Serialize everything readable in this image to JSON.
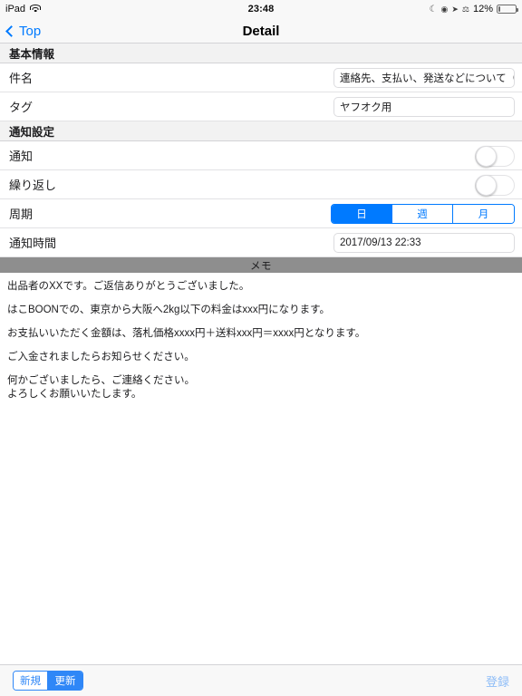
{
  "statusbar": {
    "device": "iPad",
    "wifi_icon": "wifi-icon",
    "time": "23:48",
    "moon_icon": "moon-icon",
    "alarm_icon": "alarm-clock-icon",
    "location_icon": "location-arrow-icon",
    "bluetooth_icon": "bluetooth-icon",
    "battery_percent": "12%",
    "battery_icon": "battery-icon"
  },
  "navbar": {
    "back_label": "Top",
    "back_icon": "chevron-left-icon",
    "title": "Detail"
  },
  "sections": [
    {
      "header": "基本情報",
      "rows": [
        {
          "label": "件名",
          "type": "textfield",
          "value": "連絡先、支払い、発送などについて（出…"
        },
        {
          "label": "タグ",
          "type": "textfield",
          "value": "ヤフオク用"
        }
      ]
    },
    {
      "header": "通知設定",
      "rows": [
        {
          "label": "通知",
          "type": "toggle",
          "value": "off"
        },
        {
          "label": "繰り返し",
          "type": "toggle",
          "value": "off"
        },
        {
          "label": "周期",
          "type": "segmented",
          "options": [
            "日",
            "週",
            "月"
          ],
          "selected": "日"
        },
        {
          "label": "通知時間",
          "type": "textfield",
          "value": "2017/09/13 22:33"
        }
      ]
    }
  ],
  "memo": {
    "header": "メモ",
    "paragraphs": [
      "出品者のXXです。ご返信ありがとうございました。",
      "はこBOONでの、東京から大阪へ2kg以下の料金はxxx円になります。",
      "お支払いいただく金額は、落札価格xxxx円＋送料xxx円＝xxxx円となります。",
      "ご入金されましたらお知らせください。",
      "何かございましたら、ご連絡ください。",
      "よろしくお願いいたします。"
    ]
  },
  "bottombar": {
    "mode_options": [
      "新規",
      "更新"
    ],
    "mode_selected": "更新",
    "register_label": "登録"
  },
  "colors": {
    "accent": "#007aff",
    "bottom_accent": "#2f87f7",
    "register_disabled": "#8ebdf7",
    "memo_header_bg": "#8e8e8e",
    "section_header_bg": "#f2f2f2",
    "bar_bg": "#f8f8f8"
  }
}
